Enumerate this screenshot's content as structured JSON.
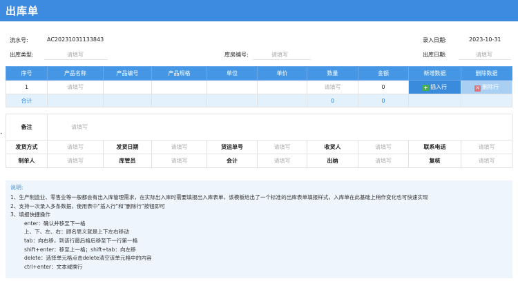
{
  "header": {
    "title": "出库单"
  },
  "meta": {
    "serial_label": "流水号:",
    "serial_value": "AC20231031133843",
    "entry_date_label": "录入日期:",
    "entry_date_value": "2023-10-31",
    "out_type_label": "出库类型:",
    "out_type_placeholder": "请填写",
    "warehouse_label": "库房编号:",
    "warehouse_placeholder": "请填写",
    "out_date_label": "出库日期:",
    "out_date_placeholder": "请填写"
  },
  "grid": {
    "headers": [
      "序号",
      "产品名称",
      "产品编号",
      "产品规格",
      "单位",
      "单价",
      "数量",
      "金额",
      "新增数据",
      "删除数据"
    ],
    "row": {
      "index": "1",
      "name": "请填写",
      "qty_placeholder": "请填写",
      "amount": "0",
      "insert_label": "插入行",
      "delete_label": "删除行"
    },
    "sum": {
      "label": "合计",
      "qty": "0",
      "amount": "0"
    }
  },
  "info": {
    "remark_label": "备注",
    "remark_placeholder": "请填写",
    "row1": [
      {
        "label": "发货方式",
        "placeholder": "请填写"
      },
      {
        "label": "发货日期",
        "placeholder": "请填写"
      },
      {
        "label": "货运单号",
        "placeholder": "请填写"
      },
      {
        "label": "收货人",
        "placeholder": "请填写"
      },
      {
        "label": "联系电话",
        "placeholder": "请填写"
      }
    ],
    "row2": [
      {
        "label": "制单人",
        "placeholder": "请填写"
      },
      {
        "label": "库管员",
        "placeholder": "请填写"
      },
      {
        "label": "会计",
        "placeholder": "请填写"
      },
      {
        "label": "出纳",
        "placeholder": "请填写"
      },
      {
        "label": "复核",
        "placeholder": "请填写"
      }
    ]
  },
  "notes": {
    "title": "说明:",
    "lines": [
      "1、生产制造业、零售业等一般都会有出入库管理需求，在实际出入库时需要填报出入库表单，该模板给出了一个标准的出库表单填报样式，入库单在此基础上稍作变化也可快速实现",
      "2、支持一次录入多条数据，使用表中\"插入行\"和\"删除行\"按钮即可",
      "3、填报快捷操作"
    ],
    "shortcuts": [
      "enter：确认并移至下一格",
      "上、下、左、右：顾名思义就是上下左右移动",
      "tab：向右移，到该行最后格后移至下一行第一格",
      "shift+enter：移至上一格；shift+tab：向左移",
      "delete：选择单元格点击delete清空该单元格中的内容",
      "ctrl+enter：文本域换行"
    ]
  },
  "colors": {
    "header": "#3d8be0",
    "table_header": "#4597e6",
    "sum_row": "#e3f1fd",
    "notes_bg": "#eef5fc"
  }
}
